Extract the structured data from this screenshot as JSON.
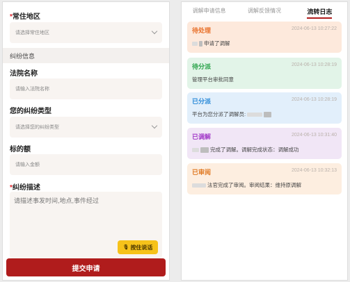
{
  "left": {
    "region_label": "常住地区",
    "region_placeholder": "请选择常住地区",
    "section_title": "纠纷信息",
    "court_label": "法院名称",
    "court_placeholder": "请输入法院名称",
    "type_label": "您的纠纷类型",
    "type_placeholder": "请选择您的纠纷类型",
    "amount_label": "标的额",
    "amount_placeholder": "请输入金额",
    "desc_label": "纠纷描述",
    "desc_placeholder": "请描述事发时间,地点,事件经过",
    "voice_button": "按住说话",
    "voice_icon": "🎙",
    "submit_button": "提交申请",
    "required_mark": "*"
  },
  "right": {
    "tabs": [
      {
        "label": "调解申请信息"
      },
      {
        "label": "调解反馈情况"
      },
      {
        "label": "流转日志"
      }
    ],
    "cards": [
      {
        "status": "待处理",
        "time": "2024-06-13 10:27:22",
        "text": "申请了调解",
        "color": "#e8702a",
        "bg": "#fde9dc"
      },
      {
        "status": "待分派",
        "time": "2024-06-13 10:28:19",
        "text": "管理平台审批同意",
        "color": "#2aa34a",
        "bg": "#e2f4e8"
      },
      {
        "status": "已分派",
        "time": "2024-06-13 10:28:19",
        "text": "平台为您分派了调解员:",
        "color": "#2a8ad8",
        "bg": "#e2effb"
      },
      {
        "status": "已调解",
        "time": "2024-06-13 10:31:40",
        "text": "完成了调解。调解完成状态：调解成功",
        "color": "#a33cc9",
        "bg": "#f1e6f6"
      },
      {
        "status": "已审阅",
        "time": "2024-06-13 10:32:13",
        "text": "法官完成了审阅。审阅结果：维持原调解",
        "color": "#e07a24",
        "bg": "#fdeee0"
      }
    ]
  }
}
